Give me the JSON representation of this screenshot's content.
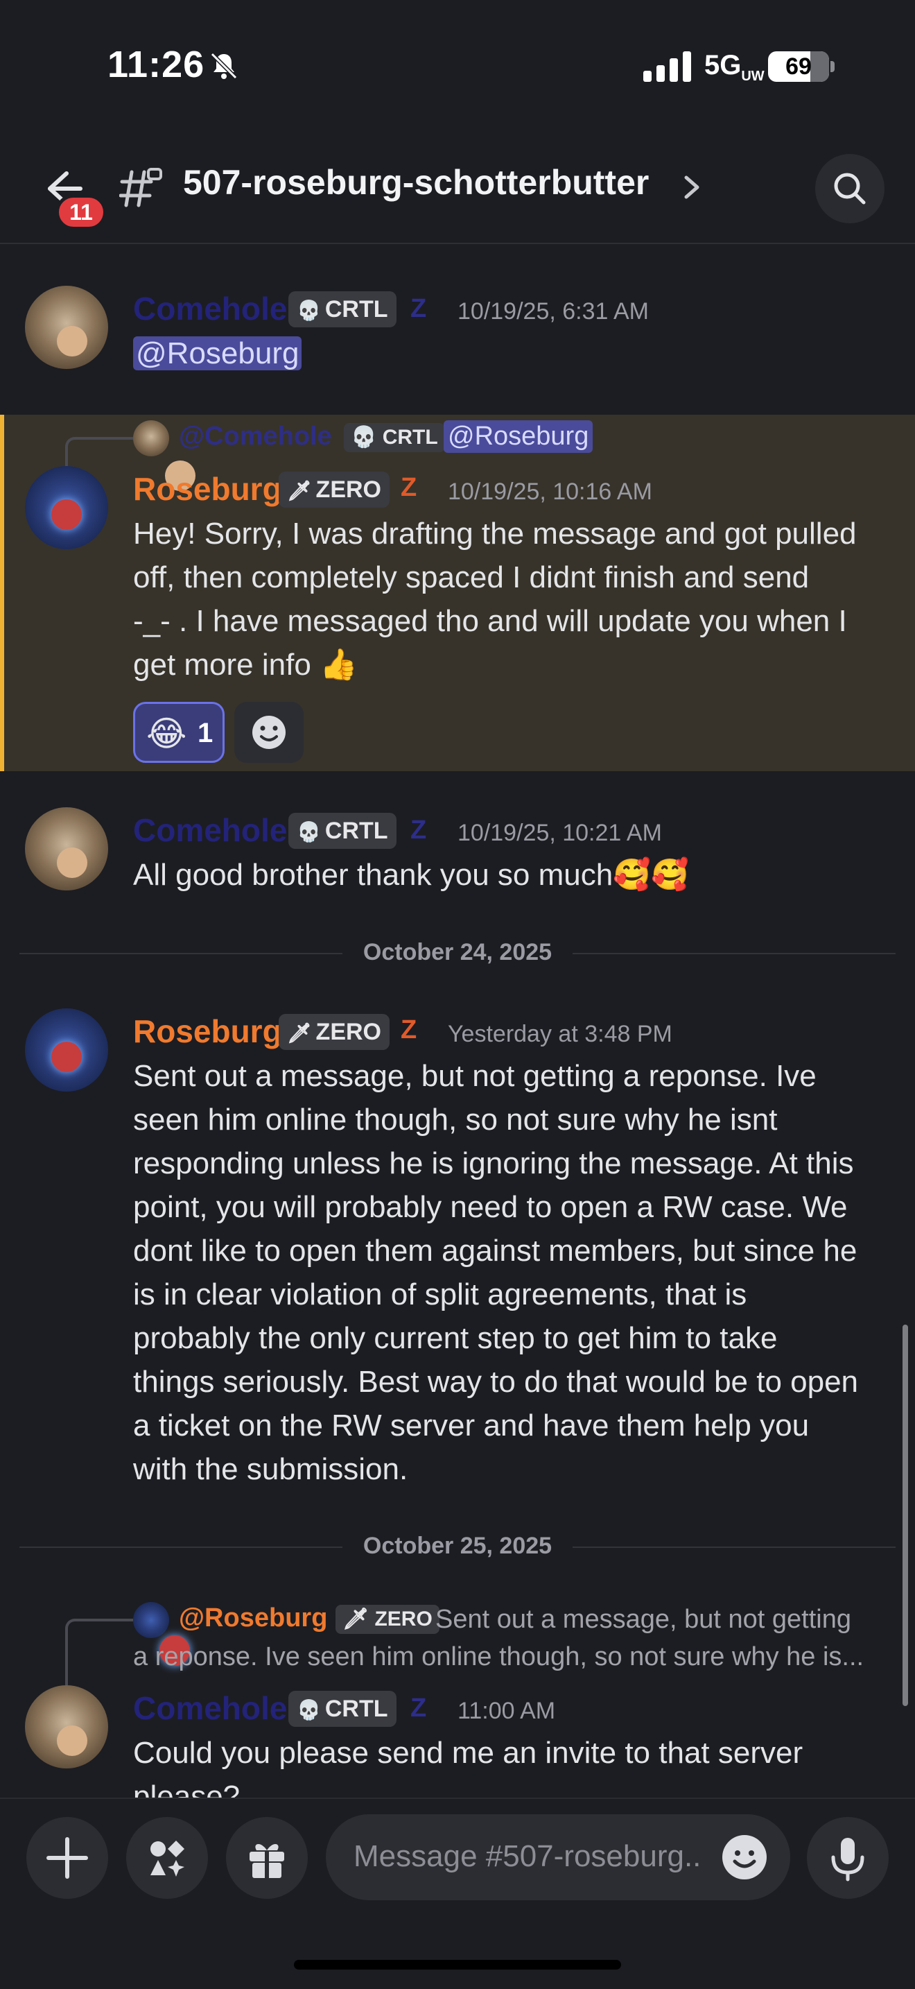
{
  "status_bar": {
    "time": "11:26",
    "network": "5G",
    "network_suffix": "UW",
    "battery_percent": 69
  },
  "header": {
    "back_badge": "11",
    "channel_name": "507-roseburg-schotterbutter",
    "chevron": "›"
  },
  "messages": [
    {
      "author": "Comehole",
      "tag": "CRTL",
      "tag_icon": "💀",
      "role_glyph": "Z",
      "timestamp": "10/19/25, 6:31 AM",
      "mention": "@Roseburg"
    },
    {
      "reply": {
        "author": "@Comehole",
        "tag": "CRTL",
        "tag_icon": "💀",
        "mention": "@Roseburg"
      },
      "author": "Roseburg",
      "tag": "ZERO",
      "tag_icon": "🗡",
      "role_glyph": "Z",
      "timestamp": "10/19/25, 10:16 AM",
      "lines": [
        "Hey! Sorry, I was drafting the message and got pulled",
        "off, then completely spaced I didnt finish and send",
        "-_- . I have messaged tho and will update you when I",
        "get more info 👍"
      ],
      "reaction_emoji": "😂",
      "reaction_count": "1"
    },
    {
      "author": "Comehole",
      "tag": "CRTL",
      "tag_icon": "💀",
      "role_glyph": "Z",
      "timestamp": "10/19/25, 10:21 AM",
      "text": "All good brother thank you so much🥰🥰"
    },
    {
      "author": "Roseburg",
      "tag": "ZERO",
      "tag_icon": "🗡",
      "role_glyph": "Z",
      "timestamp": "Yesterday at 3:48 PM",
      "lines": [
        "Sent out a message, but not getting a reponse. Ive",
        "seen him online though, so not sure why he isnt",
        "responding unless he is ignoring the message. At this",
        "point, you will probably need to open a RW case. We",
        "dont like to open them against members, but since he",
        "is in clear violation of split agreements, that is",
        "probably the only current step to get him to take",
        "things seriously. Best way to do that would be to open",
        "a ticket on the RW server and have them help you",
        "with the submission."
      ]
    },
    {
      "reply": {
        "author": "@Roseburg",
        "tag": "ZERO",
        "tag_icon": "🗡",
        "line1": "Sent out a message, but not getting",
        "line2": "a reponse. Ive seen him online though, so not sure why he is..."
      },
      "author": "Comehole",
      "tag": "CRTL",
      "tag_icon": "💀",
      "role_glyph": "Z",
      "timestamp": "11:00 AM",
      "text": "Could you please send me an invite to that server",
      "text2": "please?"
    }
  ],
  "dividers": {
    "first": "October 24, 2025",
    "second": "October 25, 2025"
  },
  "composer": {
    "placeholder": "Message #507-roseburg.."
  },
  "colors": {
    "background": "#1c1d22",
    "roseburg_name": "#f07a2e",
    "comehole_name": "#23237a",
    "highlight_border": "#f0b232",
    "mention_bg": "#4a4b9a"
  }
}
